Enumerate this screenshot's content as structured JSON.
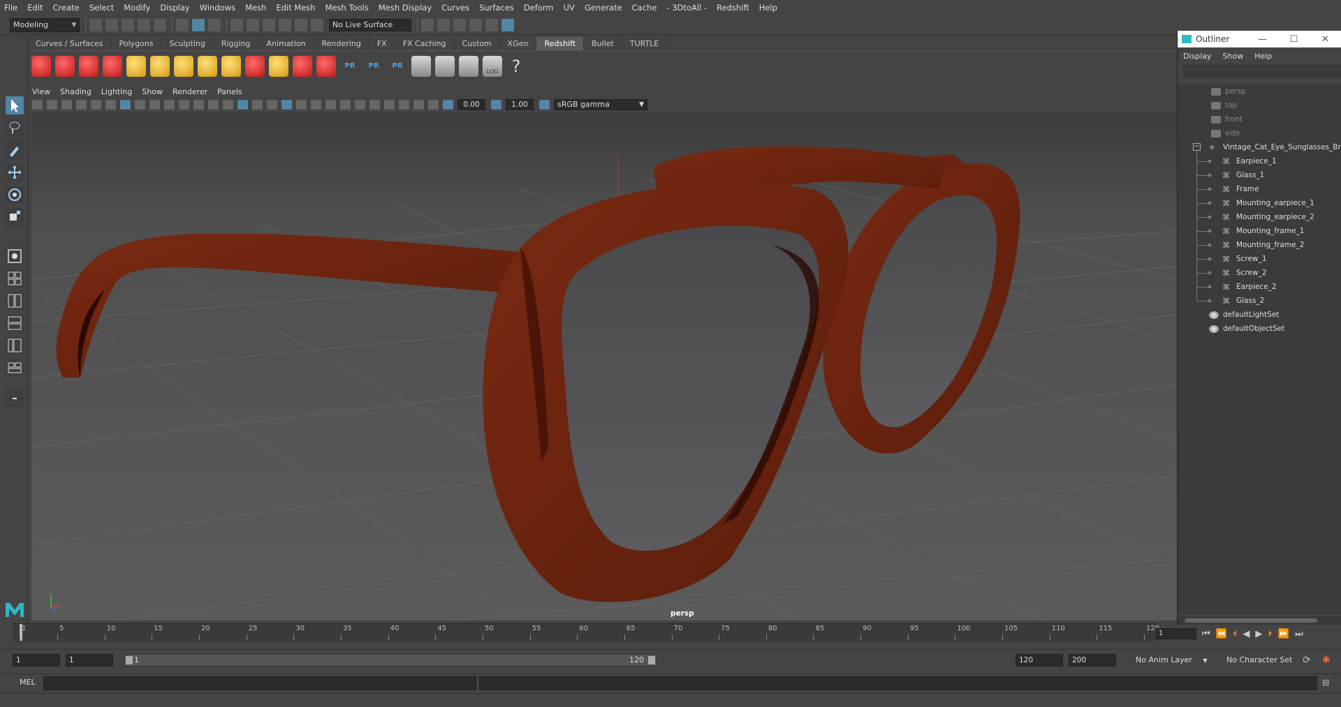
{
  "menubar": {
    "items": [
      "File",
      "Edit",
      "Create",
      "Select",
      "Modify",
      "Display",
      "Windows",
      "Mesh",
      "Edit Mesh",
      "Mesh Tools",
      "Mesh Display",
      "Curves",
      "Surfaces",
      "Deform",
      "UV",
      "Generate",
      "Cache",
      "- 3DtoAll -",
      "Redshift",
      "Help"
    ]
  },
  "statusline": {
    "mode": "Modeling",
    "live_surface": "No Live Surface"
  },
  "shelf": {
    "tabs": [
      "Curves / Surfaces",
      "Polygons",
      "Sculpting",
      "Rigging",
      "Animation",
      "Rendering",
      "FX",
      "FX Caching",
      "Custom",
      "XGen",
      "Redshift",
      "Bullet",
      "TURTLE"
    ],
    "active_tab": "Redshift",
    "icons": [
      "rv-icon",
      "rs-render-icon",
      "ipr-icon",
      "rs-settings-icon",
      "rs-light-plane-icon",
      "rs-grid-icon",
      "rs-cone-light-icon",
      "rs-dome-icon",
      "rs-sun-icon",
      "rs-box-icon",
      "rs-hair-icon",
      "rs-curve-icon",
      "rs-sphere-icon",
      "pr-icon",
      "pr-out-icon",
      "pr-swap-icon",
      "rs-bowl-icon",
      "rs-bowl2-icon",
      "code-icon",
      "log-icon",
      "help-icon"
    ],
    "pr_labels": [
      "PR",
      "PR",
      "PR"
    ],
    "log_label": "LOG"
  },
  "panel": {
    "menus": [
      "View",
      "Shading",
      "Lighting",
      "Show",
      "Renderer",
      "Panels"
    ],
    "exposure": "0.00",
    "gamma_value": "1.00",
    "color_space": "sRGB gamma",
    "camera_label": "persp"
  },
  "outliner": {
    "title": "Outliner",
    "menus": [
      "Display",
      "Show",
      "Help"
    ],
    "cameras": [
      "persp",
      "top",
      "front",
      "side"
    ],
    "group": "Vintage_Cat_Eye_Sunglasses_Brown",
    "children": [
      "Earpiece_1",
      "Glass_1",
      "Frame",
      "Mounting_earpiece_1",
      "Mounting_earpiece_2",
      "Mounting_frame_1",
      "Mounting_frame_2",
      "Screw_1",
      "Screw_2",
      "Earpiece_2",
      "Glass_2"
    ],
    "sets": [
      "defaultLightSet",
      "defaultObjectSet"
    ]
  },
  "timeline": {
    "ticks": [
      1,
      5,
      10,
      15,
      20,
      25,
      30,
      35,
      40,
      45,
      50,
      55,
      60,
      65,
      70,
      75,
      80,
      85,
      90,
      95,
      100,
      105,
      110,
      115,
      120
    ],
    "current_frame": "1"
  },
  "range": {
    "start": "1",
    "playback_start": "1",
    "slider_start": "1",
    "slider_end": "120",
    "playback_end": "120",
    "end": "200",
    "anim_layer": "No Anim Layer",
    "character_set": "No Character Set"
  },
  "command": {
    "label": "MEL"
  },
  "colors": {
    "frame_brown": "#6b2410",
    "accent_blue": "#5285a6",
    "maya_teal": "#2fb7c4"
  }
}
